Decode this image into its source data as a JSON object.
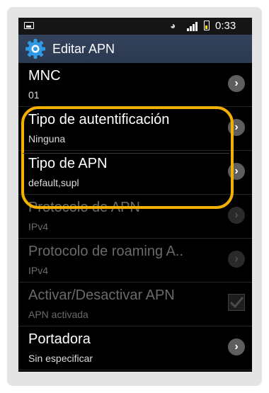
{
  "statusbar": {
    "time": "0:33",
    "icons": [
      "image-icon",
      "eye-icon",
      "signal-icon",
      "battery-icon"
    ]
  },
  "titlebar": {
    "title": "Editar APN",
    "icon": "settings-gear-icon"
  },
  "settings": [
    {
      "title": "MNC",
      "summary": "01",
      "enabled": true,
      "control": "chevron"
    },
    {
      "title": "Tipo de autentificación",
      "summary": "Ninguna",
      "enabled": true,
      "control": "chevron"
    },
    {
      "title": "Tipo de APN",
      "summary": "default,supl",
      "enabled": true,
      "control": "chevron"
    },
    {
      "title": "Protocolo de APN",
      "summary": "IPv4",
      "enabled": false,
      "control": "chevron"
    },
    {
      "title": "Protocolo de roaming A..",
      "summary": "IPv4",
      "enabled": false,
      "control": "chevron"
    },
    {
      "title": "Activar/Desactivar APN",
      "summary": "APN activada",
      "enabled": false,
      "control": "checkbox",
      "checked": true
    },
    {
      "title": "Portadora",
      "summary": "Sin especificar",
      "enabled": true,
      "control": "chevron"
    }
  ],
  "colors": {
    "highlight": "#f4b000",
    "titlebar": "#2f3e57",
    "gear": "#2d9be6"
  }
}
